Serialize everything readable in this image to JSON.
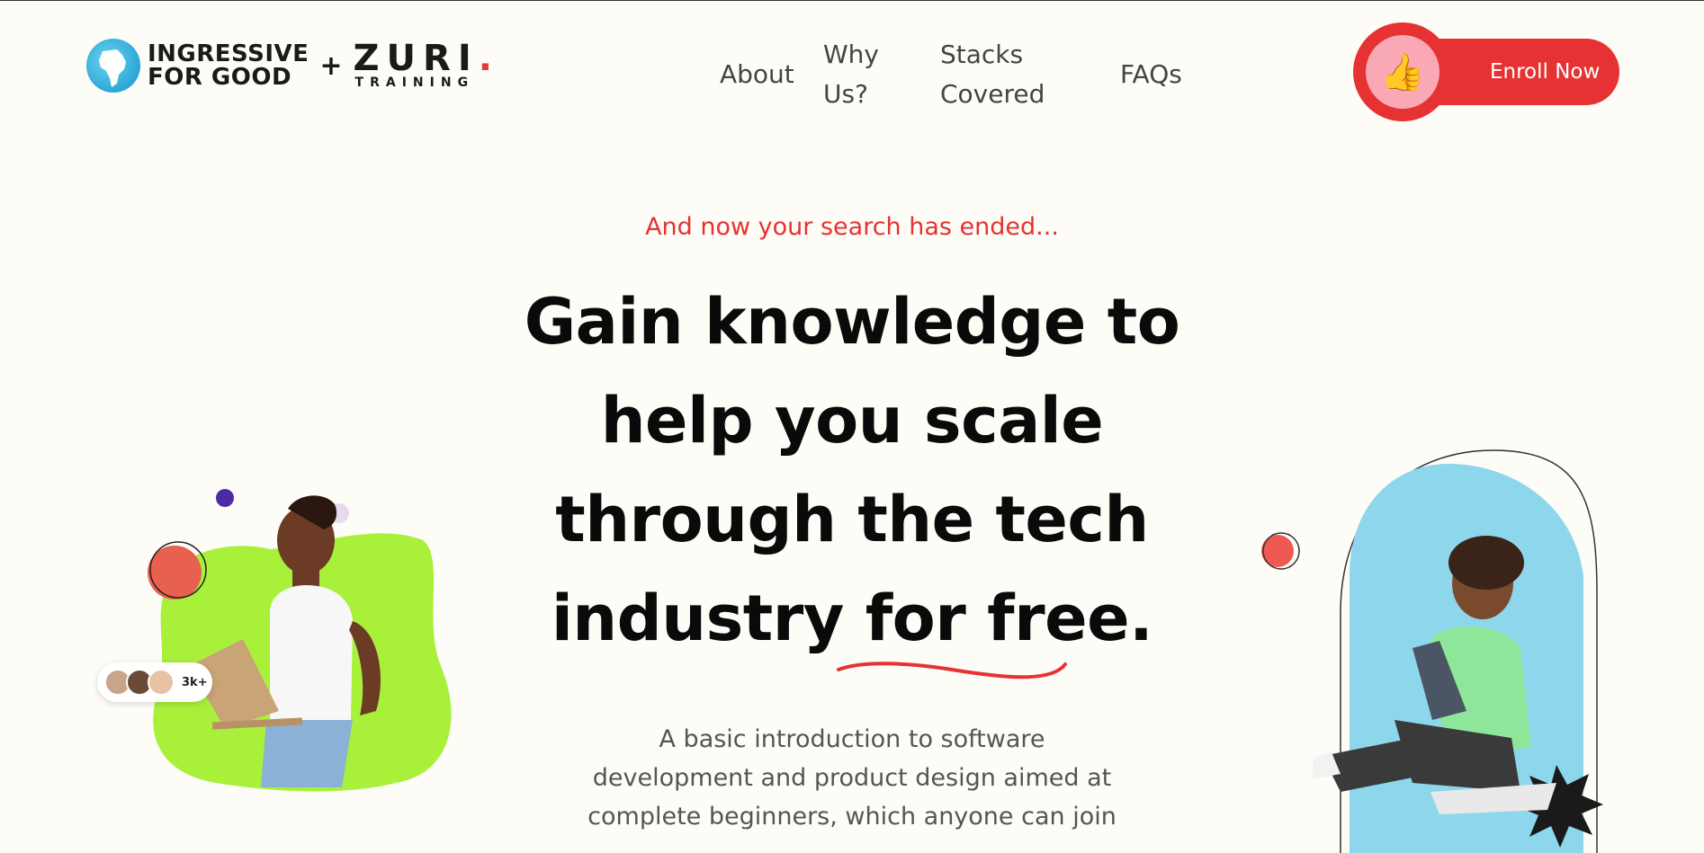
{
  "header": {
    "logo_primary": "INGRESSIVE FOR GOOD",
    "logo_primary_line1": "INGRESSIVE",
    "logo_primary_line2": "FOR GOOD",
    "logo_plus": "+",
    "logo_secondary": "ZURI",
    "logo_secondary_dot": ".",
    "logo_secondary_sub": "TRAINING"
  },
  "nav": {
    "items": [
      {
        "label": "About"
      },
      {
        "label_line1": "Why",
        "label_line2": "Us?"
      },
      {
        "label_line1": "Stacks",
        "label_line2": "Covered"
      },
      {
        "label": "FAQs"
      }
    ]
  },
  "cta": {
    "enroll_label": "Enroll Now",
    "icon": "thumbs-up-icon",
    "emoji": "👍"
  },
  "hero": {
    "tagline": "And now your search has ended...",
    "headline_lines": [
      "Gain knowledge to",
      "help you scale",
      "through the tech",
      "industry for free."
    ],
    "description_lines": [
      "A basic introduction to software",
      "development and product design aimed at",
      "complete beginners, which anyone can join"
    ],
    "students_count": "3k+"
  },
  "colors": {
    "accent": "#e63232",
    "background": "#fefcf6",
    "lime": "#a8f03a",
    "sky": "#8dd6ec",
    "purple": "#4b2aa3"
  }
}
